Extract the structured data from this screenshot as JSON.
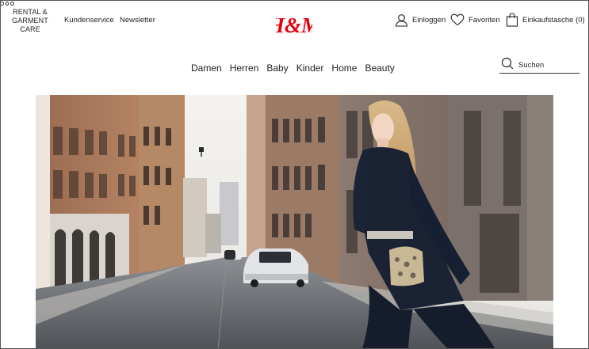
{
  "header": {
    "rental_lines": [
      "RENTAL &",
      "GARMENT",
      "CARE"
    ],
    "customer_service": "Kundenservice",
    "newsletter": "Newsletter",
    "more_icon": "more-dots-icon",
    "logo_text": "H&M",
    "login": "Einloggen",
    "favorites": "Favoriten",
    "bag": "Einkaufstasche (0)",
    "brand_color": "#e50010"
  },
  "nav": {
    "items": [
      "Damen",
      "Herren",
      "Baby",
      "Kinder",
      "Home",
      "Beauty"
    ]
  },
  "search": {
    "placeholder": "Suchen",
    "icon": "search-icon"
  },
  "hero": {
    "description_icon": "hero-campaign-image"
  }
}
